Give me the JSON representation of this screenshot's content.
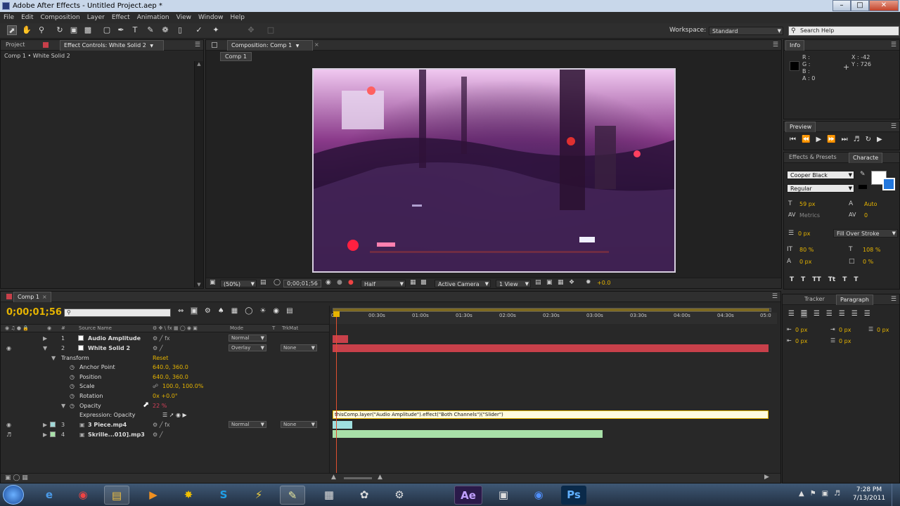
{
  "window": {
    "title": "Adobe After Effects - Untitled Project.aep *"
  },
  "menu": [
    "File",
    "Edit",
    "Composition",
    "Layer",
    "Effect",
    "Animation",
    "View",
    "Window",
    "Help"
  ],
  "toolbar": {
    "workspace_label": "Workspace:",
    "workspace_value": "Standard",
    "search_placeholder": "Search Help"
  },
  "project_panel": {
    "tab_project": "Project",
    "tab_effect_controls": "Effect Controls: White Solid 2",
    "breadcrumb": "Comp 1 • White Solid 2"
  },
  "composition_panel": {
    "tab": "Composition: Comp 1",
    "sub_tab": "Comp 1",
    "zoom": "(50%)",
    "timecode": "0;00;01;56",
    "resolution": "Half",
    "camera": "Active Camera",
    "views": "1 View",
    "exposure": "+0.0"
  },
  "info_panel": {
    "tab": "Info",
    "r": "R :",
    "g": "G :",
    "b": "B :",
    "a": "A : 0",
    "x": "X : -42",
    "y": "Y : 726"
  },
  "preview_panel": {
    "tab": "Preview"
  },
  "character_panel": {
    "tab_effects": "Effects & Presets",
    "tab_character": "Characte",
    "font": "Cooper Black",
    "style": "Regular",
    "size": "59 px",
    "leading": "Auto",
    "kerning": "Metrics",
    "tracking": "0",
    "stroke_width": "0 px",
    "stroke_mode": "Fill Over Stroke",
    "vscale": "80 %",
    "hscale": "108 %",
    "baseline": "0 px",
    "tsume": "0 %"
  },
  "paragraph_panel": {
    "tab_tracker": "Tracker",
    "tab_paragraph": "Paragraph",
    "indent_left": "0 px",
    "indent_right": "0 px",
    "first_line": "0 px",
    "space_before": "0 px",
    "space_after": "0 px"
  },
  "timeline": {
    "tab": "Comp 1",
    "timecode": "0;00;01;56",
    "col_source": "Source Name",
    "col_mode": "Mode",
    "col_t": "T",
    "col_trkmat": "TrkMat",
    "ruler": [
      "0f",
      "00:30s",
      "01:00s",
      "01:30s",
      "02:00s",
      "02:30s",
      "03:00s",
      "03:30s",
      "04:00s",
      "04:30s",
      "05:0"
    ],
    "layers": [
      {
        "num": "1",
        "name": "Audio Amplitude",
        "mode": "Normal",
        "trkmat": ""
      },
      {
        "num": "2",
        "name": "White Solid 2",
        "mode": "Overlay",
        "trkmat": "None"
      },
      {
        "num": "3",
        "name": "3 Piece.mp4",
        "mode": "Normal",
        "trkmat": "None"
      },
      {
        "num": "4",
        "name": "Skrille...010].mp3",
        "mode": "",
        "trkmat": ""
      }
    ],
    "transform": {
      "label": "Transform",
      "reset": "Reset",
      "anchor_label": "Anchor Point",
      "anchor_value": "640.0, 360.0",
      "position_label": "Position",
      "position_value": "640.0, 360.0",
      "scale_label": "Scale",
      "scale_value": "100.0, 100.0%",
      "rotation_label": "Rotation",
      "rotation_value": "0x +0.0°",
      "opacity_label": "Opacity",
      "opacity_value": "22 %",
      "expression_label": "Expression: Opacity"
    },
    "expression": "thisComp.layer(\"Audio Amplitude\").effect(\"Both Channels\")(\"Slider\")"
  },
  "taskbar": {
    "time": "7:28 PM",
    "date": "7/13/2011",
    "apps": [
      "start-orb",
      "internet-explorer",
      "chrome",
      "explorer",
      "media-player",
      "runner-app",
      "skype",
      "winamp",
      "notepad-app",
      "calculator",
      "dragon-app",
      "steam",
      "after-effects",
      "screen-app",
      "firefox-blue",
      "photoshop"
    ],
    "ae_label": "Ae",
    "ps_label": "Ps"
  },
  "colors": {
    "accent_yellow": "#e6b400",
    "layer_red": "#c8404a",
    "layer_green": "#a8e0a8",
    "playhead": "#e05030"
  }
}
